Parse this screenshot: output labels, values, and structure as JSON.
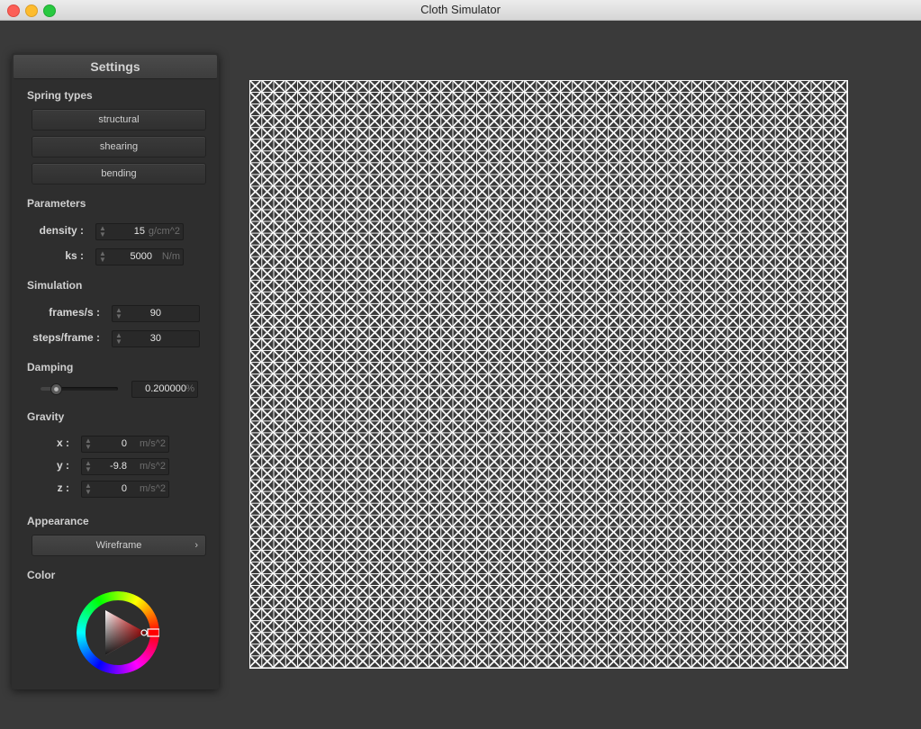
{
  "window": {
    "title": "Cloth Simulator"
  },
  "panel": {
    "title": "Settings",
    "spring_types": {
      "heading": "Spring types",
      "buttons": [
        "structural",
        "shearing",
        "bending"
      ]
    },
    "parameters": {
      "heading": "Parameters",
      "density": {
        "label": "density :",
        "value": "15",
        "unit": "g/cm^2"
      },
      "ks": {
        "label": "ks :",
        "value": "5000",
        "unit": "N/m"
      }
    },
    "simulation": {
      "heading": "Simulation",
      "fps": {
        "label": "frames/s :",
        "value": "90"
      },
      "steps": {
        "label": "steps/frame :",
        "value": "30"
      }
    },
    "damping": {
      "heading": "Damping",
      "value": "0.200000",
      "unit": "%",
      "slider_fraction": 0.2
    },
    "gravity": {
      "heading": "Gravity",
      "x": {
        "label": "x :",
        "value": "0",
        "unit": "m/s^2"
      },
      "y": {
        "label": "y :",
        "value": "-9.8",
        "unit": "m/s^2"
      },
      "z": {
        "label": "z :",
        "value": "0",
        "unit": "m/s^2"
      }
    },
    "appearance": {
      "heading": "Appearance",
      "mode": "Wireframe"
    },
    "color": {
      "heading": "Color",
      "selected": "#ff0000"
    }
  },
  "viewport": {
    "background": "#3a3a3a",
    "wire_color": "#ffffff"
  }
}
